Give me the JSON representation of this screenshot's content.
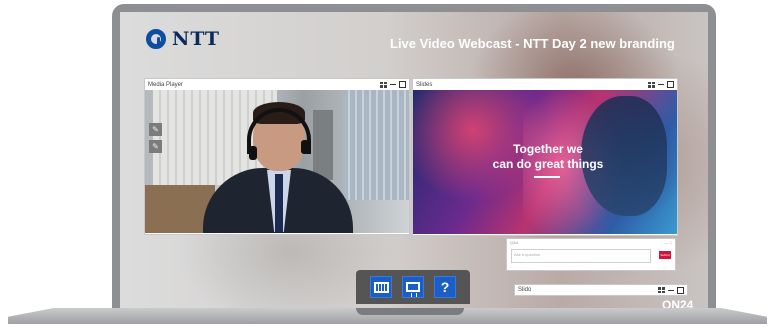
{
  "brand": {
    "logo_text": "NTT",
    "logo_color": "#0b4ea2"
  },
  "event": {
    "title": "Live Video Webcast - NTT Day 2 new branding"
  },
  "panels": {
    "media_player": {
      "title": "Media Player"
    },
    "slides": {
      "title": "Slides",
      "slide_text_line1": "Together we",
      "slide_text_line2": "can do great things"
    },
    "qa": {
      "title": "Q&A",
      "placeholder": "Ask a question",
      "submit_label": "Submit"
    },
    "slido": {
      "title": "Slido"
    }
  },
  "dock": {
    "help_label": "?"
  },
  "footer": {
    "logo_text": "ON24"
  },
  "colors": {
    "dock_bg": "#555555",
    "dock_button": "#1a5fc8",
    "submit_button": "#d0163a"
  }
}
